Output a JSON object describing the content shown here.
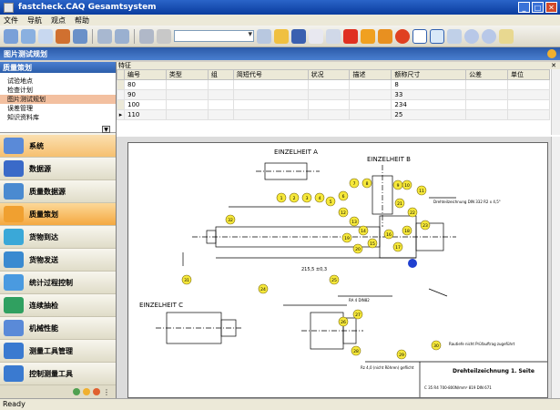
{
  "window": {
    "title": "fastcheck.CAQ Gesamtsystem"
  },
  "menu": {
    "items": [
      "文件",
      "导航",
      "观点",
      "帮助"
    ]
  },
  "banner": {
    "title": "图片测试规划"
  },
  "left_panel": {
    "header": "质量策划",
    "list_items": [
      "试验地点",
      "检查计划",
      "图片测试规划",
      "误差管理",
      "知识资料库"
    ],
    "selected_index": 2,
    "nav_buttons": [
      {
        "label": "系统",
        "icon": "system-icon",
        "color": "#5a8ad8"
      },
      {
        "label": "数据源",
        "icon": "database-icon",
        "color": "#3a6ac8"
      },
      {
        "label": "质量数据源",
        "icon": "quality-data-icon",
        "color": "#4a8ad0"
      },
      {
        "label": "质量策划",
        "icon": "quality-planning-icon",
        "color": "#f0a030"
      },
      {
        "label": "货物到达",
        "icon": "goods-in-icon",
        "color": "#3aa8d8"
      },
      {
        "label": "货物发送",
        "icon": "goods-out-icon",
        "color": "#3a8ad0"
      },
      {
        "label": "统计过程控制",
        "icon": "spc-icon",
        "color": "#4a9ae0"
      },
      {
        "label": "连续抽检",
        "icon": "sampling-icon",
        "color": "#30a060"
      },
      {
        "label": "机械性能",
        "icon": "machine-icon",
        "color": "#5a8ad8"
      },
      {
        "label": "测量工具管理",
        "icon": "gauge-mgmt-icon",
        "color": "#3a7ad0"
      },
      {
        "label": "控制测量工具",
        "icon": "gauge-control-icon",
        "color": "#3a7ad0"
      }
    ],
    "active_index": 3,
    "highlight_index": 0
  },
  "grid": {
    "title": "特征",
    "columns": [
      "编号",
      "类型",
      "组",
      "简短代号",
      "状况",
      "描述",
      "额称尺寸",
      "公差",
      "单位"
    ],
    "rows": [
      [
        "80",
        "",
        "",
        "",
        "",
        "",
        "8",
        "",
        ""
      ],
      [
        "90",
        "",
        "",
        "",
        "",
        "",
        "33",
        "",
        ""
      ],
      [
        "100",
        "",
        "",
        "",
        "",
        "",
        "234",
        "",
        ""
      ],
      [
        "110",
        "",
        "",
        "",
        "",
        "",
        "25",
        "",
        ""
      ]
    ],
    "current_row_marker": "▸"
  },
  "drawing": {
    "label_a": "EINZELHEIT A",
    "label_b": "EINZELHEIT B",
    "label_c": "EINZELHEIT C",
    "title_block": "Drehteilzeichnung 1. Seite",
    "note_roughness": "Rautiefe nicht Prüfauftrag zugeführt",
    "note_edges": "Rz 4,0 (nicht Röhren) geflicht",
    "note_material": "C 35 R4 700-800N/mm² 819 DIN 671",
    "note_thread": "Drehteilzeichnung DIN 332 R2 x 4,5°",
    "note_ra": "RA 4 DIN82",
    "dim_main": "215,5 ±0,3",
    "balloons": [
      "1",
      "2",
      "3",
      "4",
      "5",
      "6",
      "7",
      "8",
      "9",
      "10",
      "11",
      "12",
      "13",
      "14",
      "15",
      "16",
      "17",
      "18",
      "19",
      "20",
      "21",
      "22",
      "23",
      "24",
      "25",
      "26",
      "27",
      "28",
      "29",
      "30",
      "31",
      "32"
    ]
  },
  "status": {
    "text": "Ready"
  }
}
